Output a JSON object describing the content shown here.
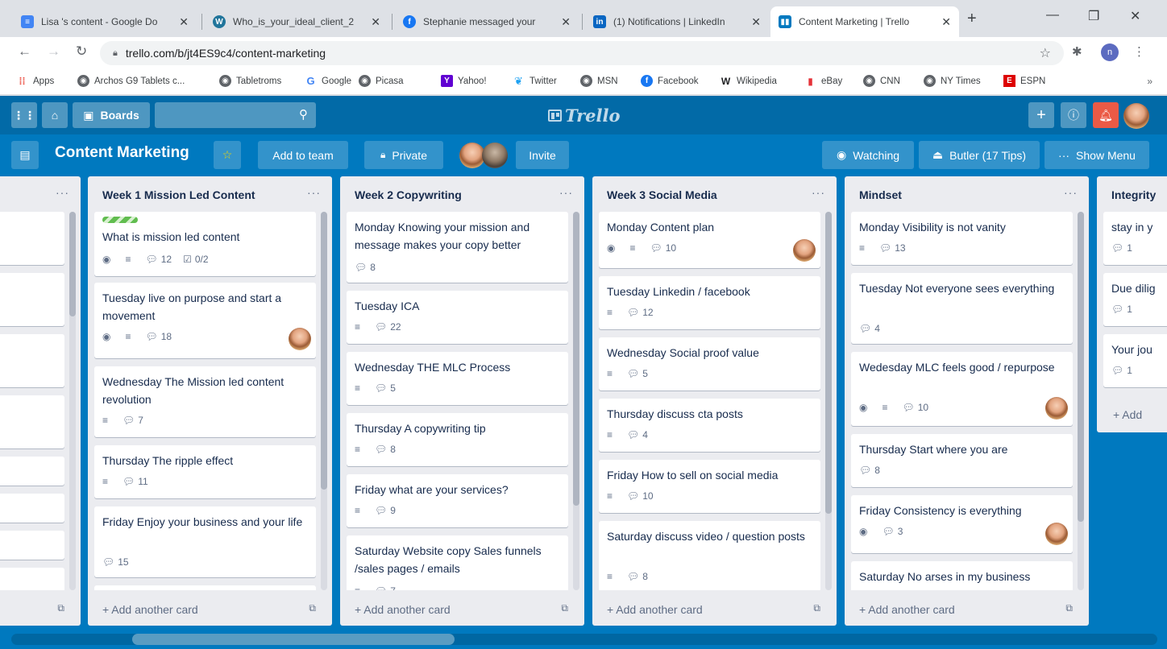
{
  "browser": {
    "tabs": [
      {
        "title": "Lisa 's content - Google Do",
        "icon": "google-docs-icon",
        "color": "#4285f4"
      },
      {
        "title": "Who_is_your_ideal_client_2",
        "icon": "wordpress-icon",
        "color": "#21759b"
      },
      {
        "title": "Stephanie messaged your",
        "icon": "facebook-icon",
        "color": "#1877f2"
      },
      {
        "title": "(1) Notifications | LinkedIn",
        "icon": "linkedin-icon",
        "color": "#0a66c2"
      },
      {
        "title": "Content Marketing | Trello",
        "icon": "trello-icon",
        "color": "#0079bf"
      }
    ],
    "url": "trello.com/b/jt4ES9c4/content-marketing",
    "profile_initial": "n",
    "bookmarks": [
      {
        "label": "Apps",
        "icon": "apps-grid-icon"
      },
      {
        "label": "Archos G9 Tablets c...",
        "icon": "globe-icon"
      },
      {
        "label": "Tabletroms",
        "icon": "globe-icon"
      },
      {
        "label": "Google",
        "icon": "google-icon"
      },
      {
        "label": "Picasa",
        "icon": "globe-icon"
      },
      {
        "label": "Yahoo!",
        "icon": "yahoo-icon"
      },
      {
        "label": "Twitter",
        "icon": "twitter-icon"
      },
      {
        "label": "MSN",
        "icon": "globe-icon"
      },
      {
        "label": "Facebook",
        "icon": "facebook-icon"
      },
      {
        "label": "Wikipedia",
        "icon": "wikipedia-icon"
      },
      {
        "label": "eBay",
        "icon": "ebay-icon"
      },
      {
        "label": "CNN",
        "icon": "globe-icon"
      },
      {
        "label": "NY Times",
        "icon": "globe-icon"
      },
      {
        "label": "ESPN",
        "icon": "espn-icon"
      }
    ],
    "bookmarks_more": "»"
  },
  "trello": {
    "header": {
      "boards_label": "Boards",
      "logo_text": "Trello"
    },
    "board": {
      "title": "Content Marketing",
      "add_to_team": "Add to team",
      "private": "Private",
      "invite": "Invite",
      "watching": "Watching",
      "butler": "Butler (17 Tips)",
      "show_menu": "Show Menu"
    },
    "add_another_card": "Add another card",
    "lists": [
      {
        "title": "",
        "partial": "left"
      },
      {
        "title": "Week 1 Mission Led Content"
      },
      {
        "title": "Week 2 Copywriting"
      },
      {
        "title": "Week 3 Social Media"
      },
      {
        "title": "Mindset"
      },
      {
        "title": "Integrity",
        "partial": "right"
      }
    ],
    "cards": {
      "week1": [
        {
          "title": "What is mission led content",
          "watch": true,
          "desc": true,
          "comments": "12",
          "checklist": "0/2",
          "label": true
        },
        {
          "title": "Tuesday live on purpose and start a movement",
          "watch": true,
          "desc": true,
          "comments": "18",
          "avatar": true
        },
        {
          "title": "Wednesday The Mission led content revolution",
          "desc": true,
          "comments": "7"
        },
        {
          "title": "Thursday The ripple effect",
          "desc": true,
          "comments": "11"
        },
        {
          "title": "Friday Enjoy your business and your life",
          "comments": "15"
        }
      ],
      "week2": [
        {
          "title": "Monday Knowing your mission and message makes your copy better",
          "comments": "8"
        },
        {
          "title": "Tuesday ICA",
          "desc": true,
          "comments": "22"
        },
        {
          "title": "Wednesday THE MLC Process",
          "desc": true,
          "comments": "5"
        },
        {
          "title": "Thursday A copywriting tip",
          "desc": true,
          "comments": "8"
        },
        {
          "title": "Friday what are your services?",
          "desc": true,
          "comments": "9"
        },
        {
          "title": "Saturday Website copy Sales funnels /sales pages / emails",
          "desc": true,
          "comments": "7"
        }
      ],
      "week3": [
        {
          "title": "Monday Content plan",
          "watch": true,
          "desc": true,
          "comments": "10",
          "avatar": true
        },
        {
          "title": "Tuesday Linkedin / facebook",
          "desc": true,
          "comments": "12"
        },
        {
          "title": "Wednesday Social proof value",
          "desc": true,
          "comments": "5"
        },
        {
          "title": "Thursday discuss cta posts",
          "desc": true,
          "comments": "4"
        },
        {
          "title": "Friday How to sell on social media",
          "desc": true,
          "comments": "10"
        },
        {
          "title": "Saturday discuss video / question posts",
          "desc": true,
          "comments": "8"
        }
      ],
      "mindset": [
        {
          "title": "Monday Visibility is not vanity",
          "desc": true,
          "comments": "13"
        },
        {
          "title": "Tuesday Not everyone sees everything",
          "comments": "4"
        },
        {
          "title": "Wedesday MLC feels good / repurpose",
          "watch": true,
          "desc": true,
          "comments": "10",
          "avatar": true
        },
        {
          "title": "Thursday Start where you are",
          "comments": "8"
        },
        {
          "title": "Friday Consistency is everything",
          "watch": true,
          "comments": "3",
          "avatar": true
        },
        {
          "title": "Saturday No arses in my business"
        }
      ],
      "integrity": [
        {
          "title": "stay in y",
          "comments": "1"
        },
        {
          "title": "Due dilig",
          "comments": "1"
        },
        {
          "title": "Your jou",
          "comments": "1"
        }
      ],
      "integrity_add": "+ Add"
    },
    "colors": {
      "board_bg": "#0079bf",
      "header_bg": "#026aa7",
      "notification_red": "#eb5a46",
      "star_yellow": "#f2d600",
      "label_green": "#61bd4f"
    }
  }
}
